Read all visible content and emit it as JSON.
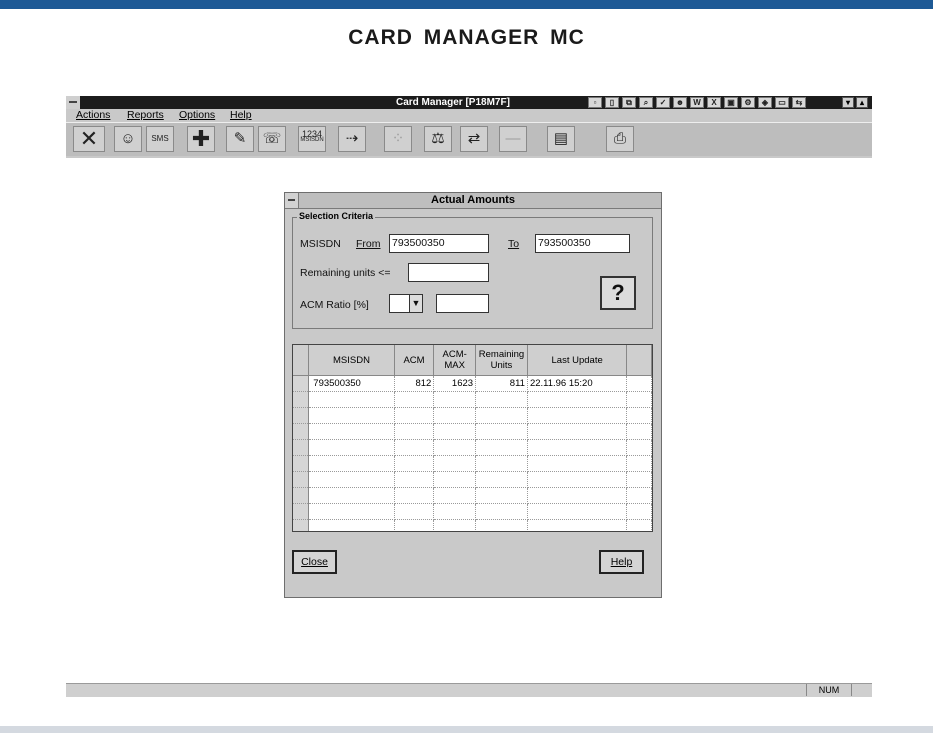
{
  "page": {
    "title": "CARD MANAGER MC"
  },
  "app": {
    "title": "Card Manager [P18M7F]",
    "menu": [
      "Actions",
      "Reports",
      "Options",
      "Help"
    ],
    "status": {
      "num_indicator": "NUM"
    }
  },
  "toolbar": {
    "msisdn_button_label": "MSISDN",
    "msisdn_button_digits": "1234",
    "sms_label": "SMS"
  },
  "dialog": {
    "title": "Actual Amounts",
    "group_label": "Selection Criteria",
    "msisdn_label": "MSISDN",
    "from_label": "From",
    "to_label": "To",
    "from_value": "793500350",
    "to_value": "793500350",
    "remaining_label": "Remaining units <=",
    "remaining_value": "",
    "acm_ratio_label": "ACM Ratio [%]",
    "acm_ratio_value": "",
    "help_symbol": "?",
    "table": {
      "headers": [
        "MSISDN",
        "ACM",
        "ACM-MAX",
        "Remaining Units",
        "Last Update"
      ],
      "rows": [
        [
          "793500350",
          "812",
          "1623",
          "811",
          "22.11.96 15:20"
        ]
      ]
    },
    "close_label": "Close",
    "help_label": "Help"
  }
}
